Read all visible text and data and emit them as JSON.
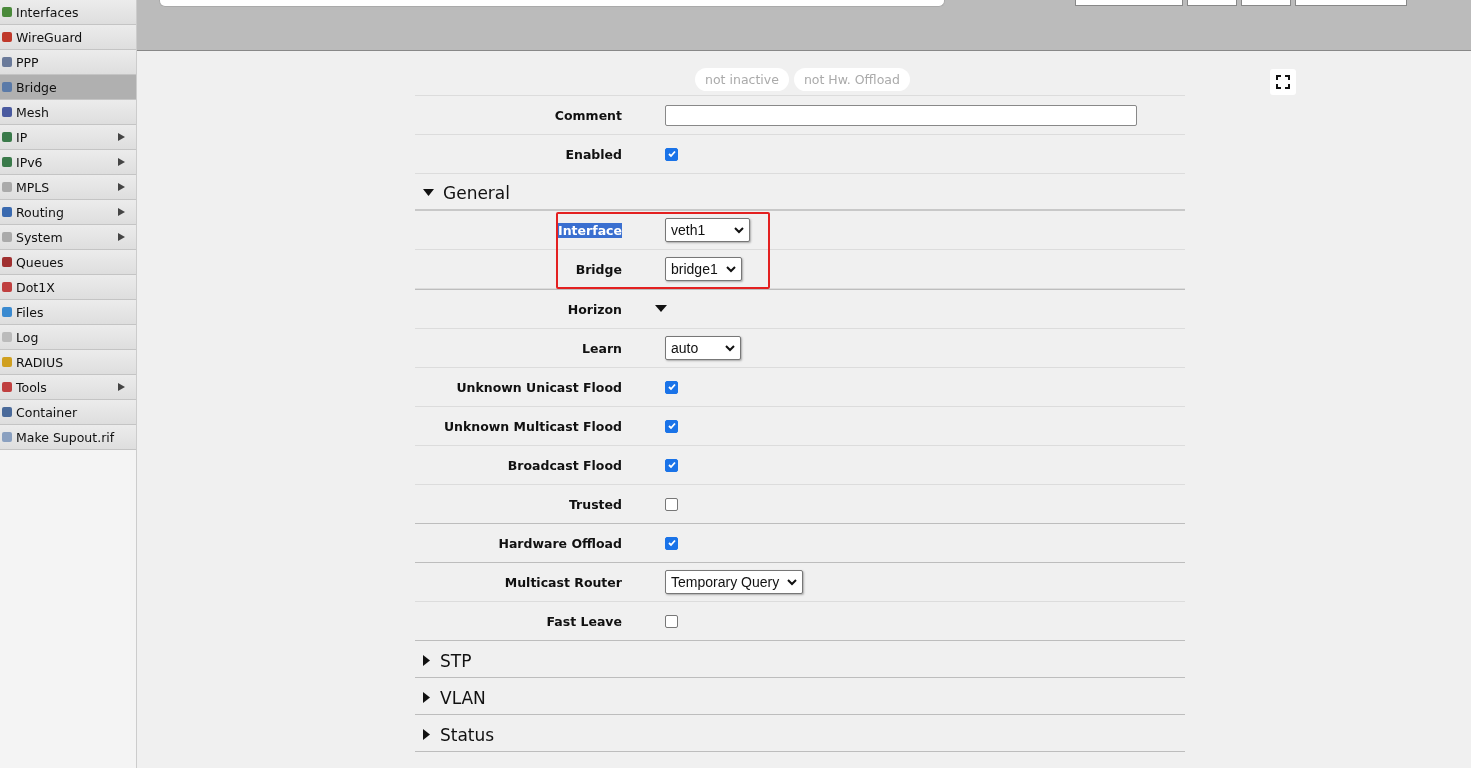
{
  "sidebar": {
    "items": [
      {
        "label": "Interfaces",
        "selected": false,
        "submenu": false
      },
      {
        "label": "WireGuard",
        "selected": false,
        "submenu": false
      },
      {
        "label": "PPP",
        "selected": false,
        "submenu": false
      },
      {
        "label": "Bridge",
        "selected": true,
        "submenu": false
      },
      {
        "label": "Mesh",
        "selected": false,
        "submenu": false
      },
      {
        "label": "IP",
        "selected": false,
        "submenu": true
      },
      {
        "label": "IPv6",
        "selected": false,
        "submenu": true
      },
      {
        "label": "MPLS",
        "selected": false,
        "submenu": true
      },
      {
        "label": "Routing",
        "selected": false,
        "submenu": true
      },
      {
        "label": "System",
        "selected": false,
        "submenu": true
      },
      {
        "label": "Queues",
        "selected": false,
        "submenu": false
      },
      {
        "label": "Dot1X",
        "selected": false,
        "submenu": false
      },
      {
        "label": "Files",
        "selected": false,
        "submenu": false
      },
      {
        "label": "Log",
        "selected": false,
        "submenu": false
      },
      {
        "label": "RADIUS",
        "selected": false,
        "submenu": false
      },
      {
        "label": "Tools",
        "selected": false,
        "submenu": true
      },
      {
        "label": "Container",
        "selected": false,
        "submenu": false
      },
      {
        "label": "Make Supout.rif",
        "selected": false,
        "submenu": false
      }
    ]
  },
  "filters": [
    {
      "label": "not inactive"
    },
    {
      "label": "not Hw. Offload"
    }
  ],
  "fields": [
    {
      "label": "Comment",
      "kind": "text"
    },
    {
      "label": "Enabled",
      "kind": "checkbox",
      "checked": true
    }
  ],
  "sections": [
    {
      "title": "General",
      "expanded": true,
      "groups": [
        {
          "annotated": true,
          "fields": [
            {
              "label": "Interface",
              "kind": "select",
              "value": "veth1",
              "highlighted": true
            },
            {
              "label": "Bridge",
              "kind": "select",
              "value": "bridge1",
              "highlighted": false
            }
          ]
        },
        {
          "fields": [
            {
              "label": "Horizon",
              "kind": "toggle"
            },
            {
              "label": "Learn",
              "kind": "select",
              "value": "auto",
              "highlighted": false
            },
            {
              "label": "Unknown Unicast Flood",
              "kind": "checkbox",
              "checked": true
            },
            {
              "label": "Unknown Multicast Flood",
              "kind": "checkbox",
              "checked": true
            },
            {
              "label": "Broadcast Flood",
              "kind": "checkbox",
              "checked": true
            },
            {
              "label": "Trusted",
              "kind": "checkbox",
              "checked": false
            }
          ]
        },
        {
          "fields": [
            {
              "label": "Hardware Offload",
              "kind": "checkbox",
              "checked": true
            }
          ]
        },
        {
          "fields": [
            {
              "label": "Multicast Router",
              "kind": "select",
              "value": "Temporary Query",
              "highlighted": false
            },
            {
              "label": "Fast Leave",
              "kind": "checkbox",
              "checked": false
            }
          ]
        }
      ]
    },
    {
      "title": "STP",
      "expanded": false
    },
    {
      "title": "VLAN",
      "expanded": false
    },
    {
      "title": "Status",
      "expanded": false
    }
  ]
}
